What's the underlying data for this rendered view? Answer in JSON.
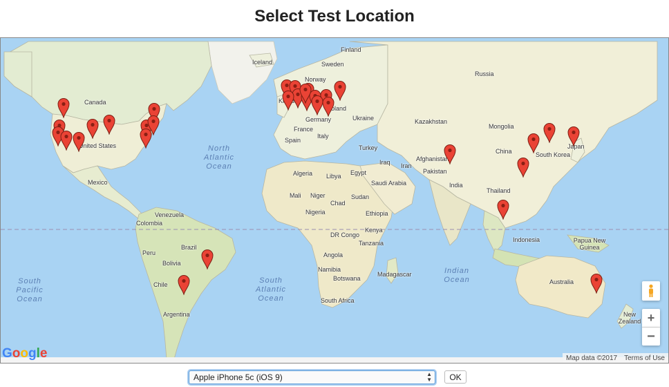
{
  "page": {
    "title": "Select Test Location"
  },
  "map": {
    "country_labels": [
      "Finland",
      "Iceland",
      "Sweden",
      "Norway",
      "Russia",
      "Canada",
      "United States",
      "Mexico",
      "Germany",
      "Poland",
      "Ukraine",
      "France",
      "Spain",
      "Italy",
      "Turkey",
      "Kazakhstan",
      "Mongolia",
      "China",
      "South Korea",
      "Japan",
      "Afghanistan",
      "Pakistan",
      "India",
      "Thailand",
      "Iraq",
      "Iran",
      "Algeria",
      "Libya",
      "Egypt",
      "Saudi Arabia",
      "Mali",
      "Niger",
      "Chad",
      "Sudan",
      "Nigeria",
      "Ethiopia",
      "Kenya",
      "DR Congo",
      "Tanzania",
      "Angola",
      "Namibia",
      "Botswana",
      "Madagascar",
      "South Africa",
      "Venezuela",
      "Colombia",
      "Peru",
      "Brazil",
      "Bolivia",
      "Chile",
      "Argentina",
      "Indonesia",
      "Papua New Guinea",
      "Australia",
      "New Zealand",
      "Kingd..."
    ],
    "ocean_labels": [
      "North Atlantic Ocean",
      "South Atlantic Ocean",
      "South Pacific Ocean",
      "Indian Ocean"
    ],
    "logo_text": "Google",
    "attribution": {
      "map_data": "Map data ©2017",
      "terms": "Terms of Use"
    },
    "controls": {
      "pegman": "pegman-icon",
      "zoom_in": "+",
      "zoom_out": "−"
    },
    "marker_color": "#ea4335",
    "marker_count": 32
  },
  "form": {
    "device_selected": "Apple iPhone 5c (iOS 9)",
    "ok_label": "OK"
  }
}
